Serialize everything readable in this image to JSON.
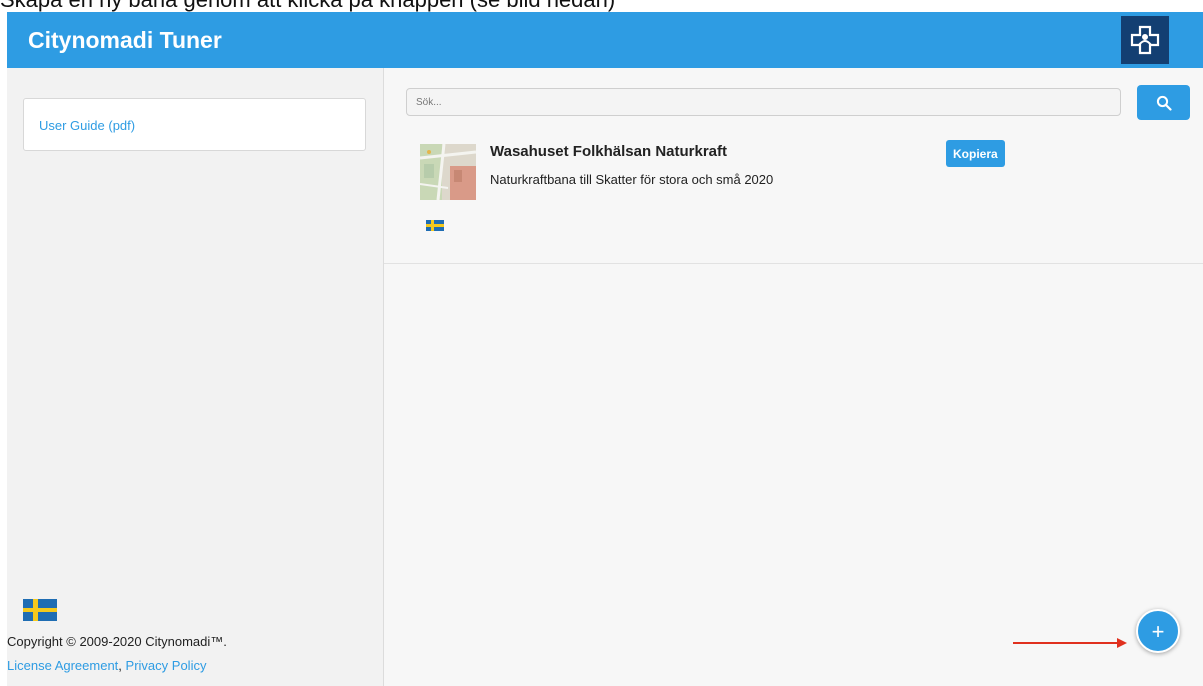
{
  "caption": "Skapa en ny bana genom att klicka på knappen (se bild nedan)",
  "header": {
    "title": "Citynomadi Tuner",
    "logo_icon": "citynomadi-logo-icon"
  },
  "sidebar": {
    "user_guide_label": "User Guide (pdf)",
    "language_flag": "swedish-flag-icon",
    "copyright": "Copyright © 2009-2020 Citynomadi™.",
    "license_label": "License Agreement",
    "separator": ",",
    "privacy_label": "Privacy Policy"
  },
  "search": {
    "placeholder": "Sök...",
    "button_icon": "search-icon"
  },
  "items": [
    {
      "title": "Wasahuset Folkhälsan Naturkraft",
      "description": "Naturkraftbana till Skatter för stora och små 2020",
      "copy_label": "Kopiera",
      "flag": "swedish-flag-icon"
    }
  ],
  "fab": {
    "label": "+",
    "icon": "add-icon"
  },
  "colors": {
    "accent": "#2e9ce3",
    "logo_bg": "#133f72",
    "arrow": "#e0301e"
  }
}
